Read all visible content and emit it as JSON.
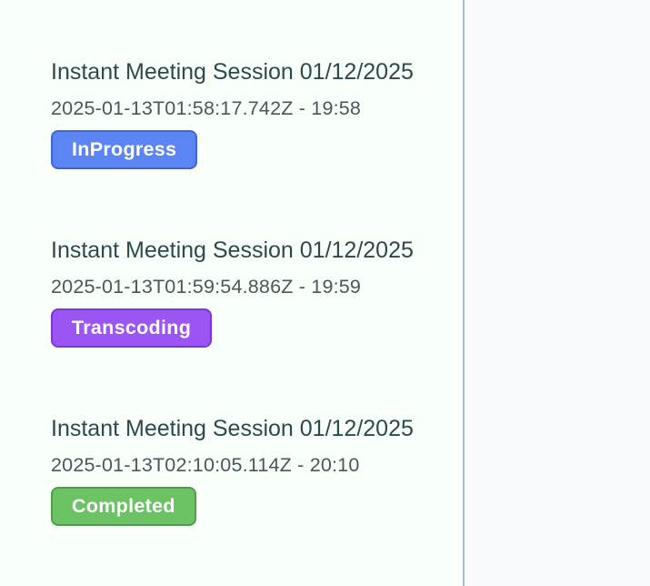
{
  "sessions": [
    {
      "title": "Instant Meeting Session 01/12/2025",
      "meta": "2025-01-13T01:58:17.742Z - 19:58",
      "status": "InProgress",
      "status_color": "#5b85f3",
      "status_border": "#3f67d6"
    },
    {
      "title": "Instant Meeting Session 01/12/2025",
      "meta": "2025-01-13T01:59:54.886Z - 19:59",
      "status": "Transcoding",
      "status_color": "#9b55f2",
      "status_border": "#7c36d9"
    },
    {
      "title": "Instant Meeting Session 01/12/2025",
      "meta": "2025-01-13T02:10:05.114Z - 20:10",
      "status": "Completed",
      "status_color": "#6cc364",
      "status_border": "#4d9f46"
    }
  ]
}
